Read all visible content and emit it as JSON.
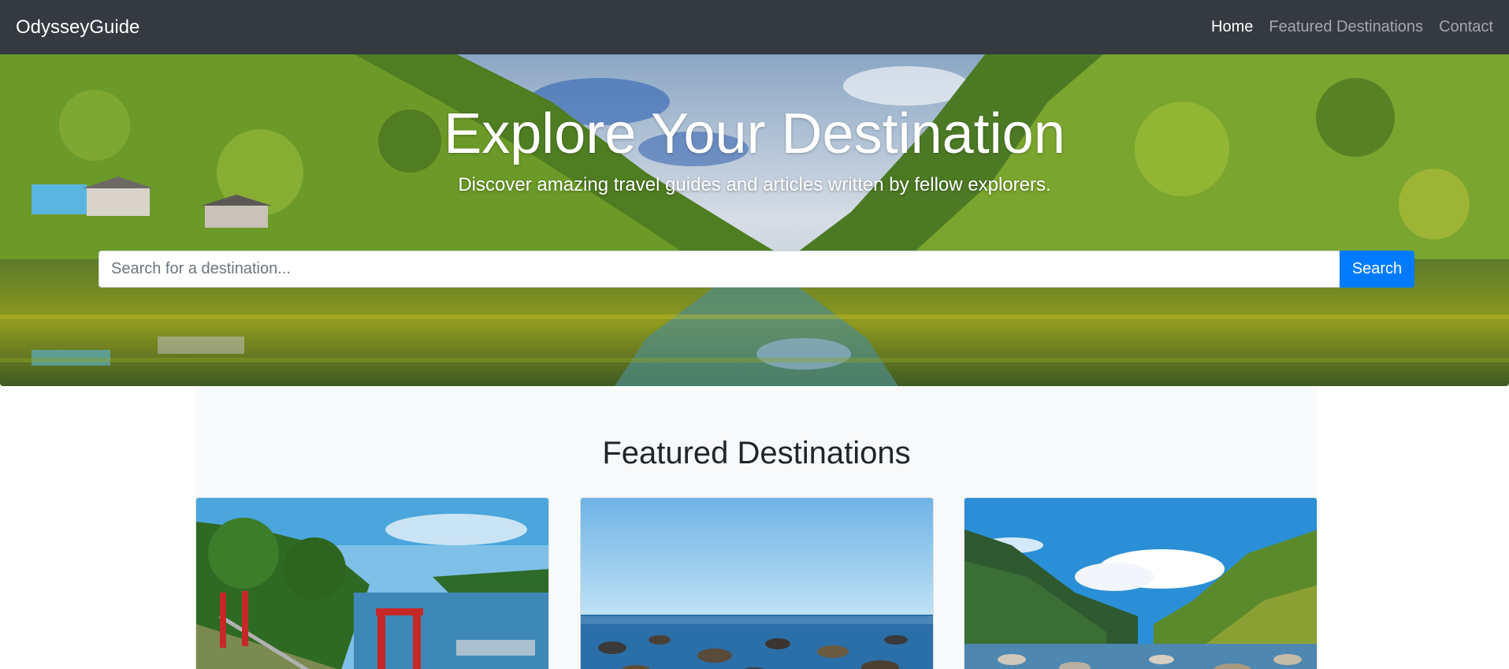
{
  "navbar": {
    "brand": "OdysseyGuide",
    "links": [
      {
        "label": "Home",
        "active": true
      },
      {
        "label": "Featured Destinations",
        "active": false
      },
      {
        "label": "Contact",
        "active": false
      }
    ]
  },
  "hero": {
    "title": "Explore Your Destination",
    "subtitle": "Discover amazing travel guides and articles written by fellow explorers.",
    "search": {
      "placeholder": "Search for a destination...",
      "value": "",
      "button_label": "Search"
    }
  },
  "featured": {
    "title": "Featured Destinations",
    "cards": [
      {
        "image": "lake-with-red-suspension-bridge-photo"
      },
      {
        "image": "rocky-sea-beach-photo"
      },
      {
        "image": "mountain-river-valley-photo"
      }
    ]
  },
  "colors": {
    "navbar_bg": "#343a40",
    "primary": "#007bff",
    "section_bg": "#f8f9fa"
  }
}
